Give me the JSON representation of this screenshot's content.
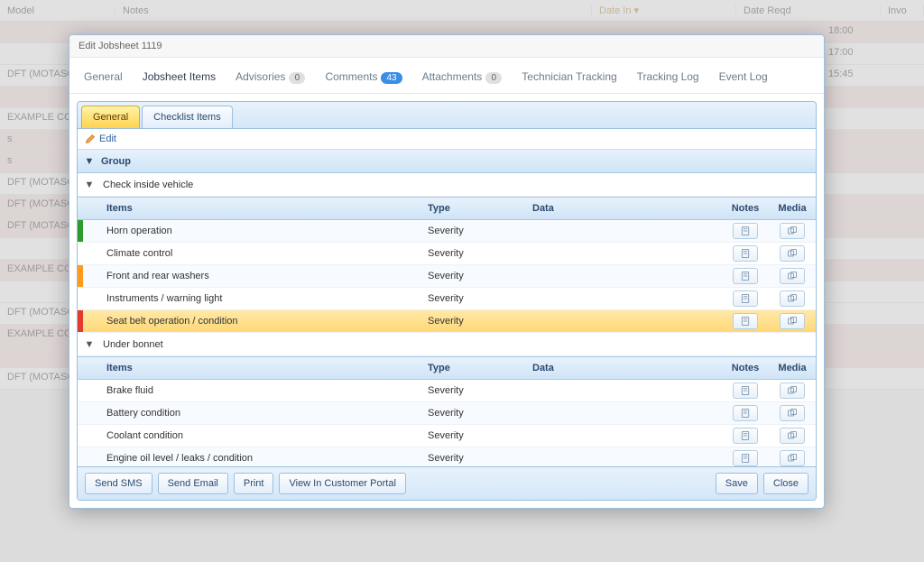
{
  "bg": {
    "cols": {
      "model": "Model",
      "notes": "Notes",
      "date_in": "Date In ▾",
      "date_reqd": "Date Reqd",
      "invo": "Invo"
    },
    "rows": [
      "",
      "",
      "DFT (MOTASOFT ...)",
      "",
      "EXAMPLE COMP...",
      "s",
      "s",
      "DFT (MOTASOFT ...)",
      "DFT (MOTASOFT ...)",
      "DFT (MOTASOFT ...)",
      "",
      "EXAMPLE COMP...",
      "",
      "DFT (MOTASOFT ...)",
      "EXAMPLE COMP...",
      "",
      "DFT (MOTASOFT ...)"
    ],
    "right": [
      "18:00",
      "17:00",
      "15:45"
    ]
  },
  "modal": {
    "title": "Edit Jobsheet 1119",
    "tabs": {
      "general": "General",
      "jobsheet_items": "Jobsheet Items",
      "advisories": "Advisories",
      "advisories_count": "0",
      "comments": "Comments",
      "comments_count": "43",
      "attachments": "Attachments",
      "attachments_count": "0",
      "tech_tracking": "Technician Tracking",
      "tracking_log": "Tracking Log",
      "event_log": "Event Log"
    },
    "inner_tabs": {
      "general": "General",
      "checklist": "Checklist Items"
    },
    "edit_label": "Edit",
    "group_header": "Group",
    "cols": {
      "items": "Items",
      "type": "Type",
      "data": "Data",
      "notes": "Notes",
      "media": "Media"
    },
    "groups": [
      {
        "name": "Check inside vehicle",
        "items": [
          {
            "name": "Horn operation",
            "type": "Severity",
            "sev": "green",
            "selected": false
          },
          {
            "name": "Climate control",
            "type": "Severity",
            "sev": "none",
            "selected": false
          },
          {
            "name": "Front and rear washers",
            "type": "Severity",
            "sev": "orange",
            "selected": false
          },
          {
            "name": "Instruments / warning light",
            "type": "Severity",
            "sev": "none",
            "selected": false
          },
          {
            "name": "Seat belt operation / condition",
            "type": "Severity",
            "sev": "red",
            "selected": true
          }
        ]
      },
      {
        "name": "Under bonnet",
        "items": [
          {
            "name": "Brake fluid",
            "type": "Severity",
            "sev": "none",
            "selected": false
          },
          {
            "name": "Battery condition",
            "type": "Severity",
            "sev": "none",
            "selected": false
          },
          {
            "name": "Coolant condition",
            "type": "Severity",
            "sev": "none",
            "selected": false
          },
          {
            "name": "Engine oil level / leaks / condition",
            "type": "Severity",
            "sev": "none",
            "selected": false
          }
        ]
      }
    ],
    "buttons": {
      "send_sms": "Send SMS",
      "send_email": "Send Email",
      "print": "Print",
      "view_portal": "View In Customer Portal",
      "save": "Save",
      "close": "Close"
    }
  }
}
